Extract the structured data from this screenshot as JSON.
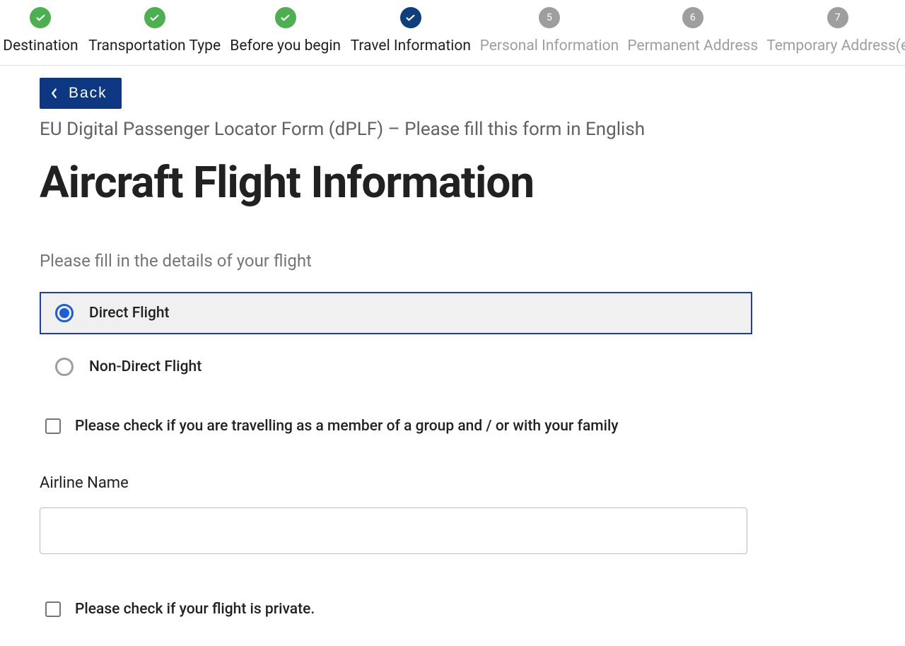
{
  "stepper": {
    "items": [
      {
        "label": "Destination",
        "state": "done"
      },
      {
        "label": "Transportation Type",
        "state": "done"
      },
      {
        "label": "Before you begin",
        "state": "done"
      },
      {
        "label": "Travel Information",
        "state": "active"
      },
      {
        "label": "Personal Information",
        "state": "pending",
        "num": "5"
      },
      {
        "label": "Permanent Address",
        "state": "pending",
        "num": "6"
      },
      {
        "label": "Temporary Address(e",
        "state": "pending",
        "num": "7"
      }
    ]
  },
  "backLabel": "Back",
  "subtitle": "EU Digital Passenger Locator Form (dPLF) – Please fill this form in English",
  "pageTitle": "Aircraft Flight Information",
  "helper": "Please fill in the details of your flight",
  "flightType": {
    "options": [
      {
        "label": "Direct Flight",
        "checked": true
      },
      {
        "label": "Non-Direct Flight",
        "checked": false
      }
    ]
  },
  "groupCheck": {
    "label": "Please check if you are travelling as a member of a group and / or with your family",
    "checked": false
  },
  "airlineField": {
    "label": "Airline Name",
    "value": ""
  },
  "privateCheck": {
    "label": "Please check if your flight is private.",
    "checked": false
  }
}
